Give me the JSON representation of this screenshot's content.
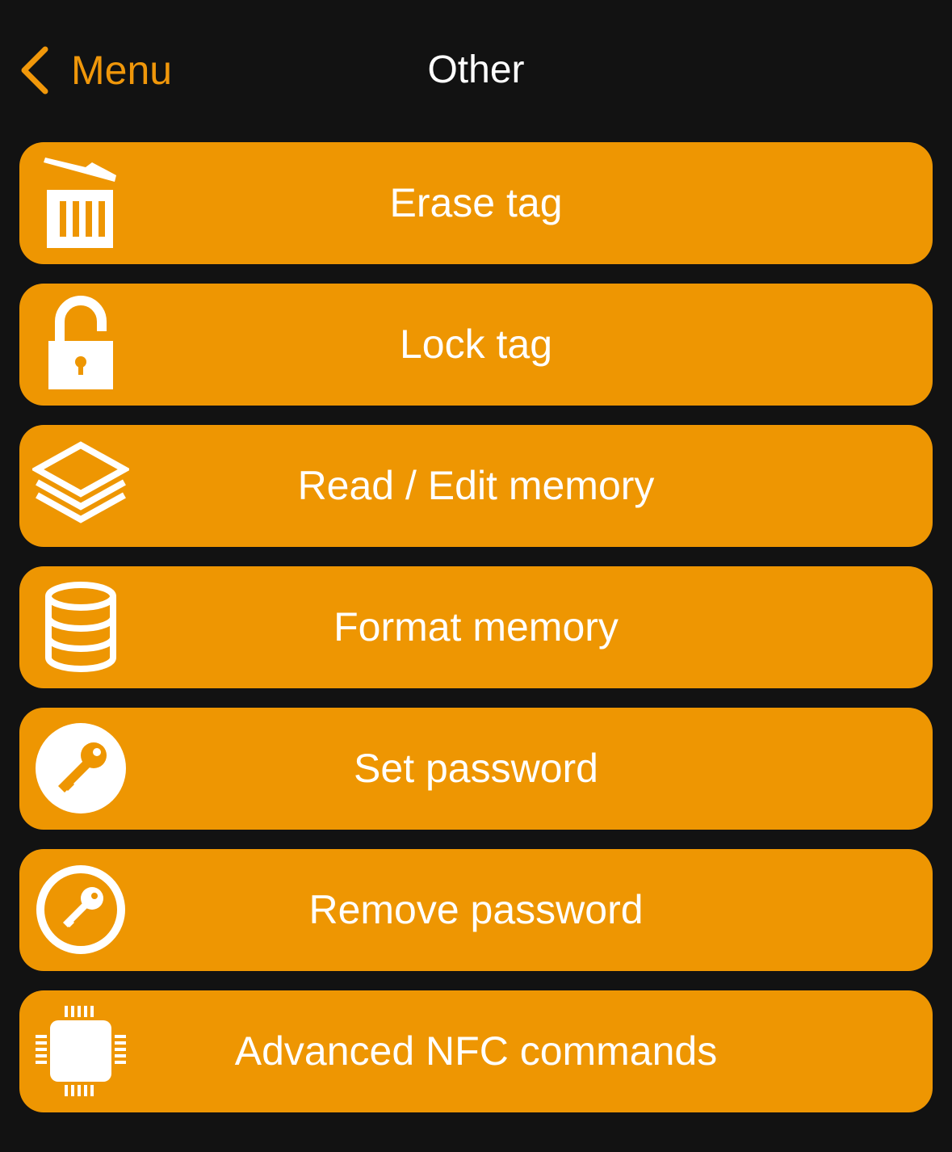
{
  "nav": {
    "back_label": "Menu",
    "title": "Other"
  },
  "colors": {
    "background": "#121212",
    "accent": "#F0970A",
    "button": "#EE9602",
    "text": "#FFFFFF"
  },
  "items": [
    {
      "label": "Erase tag",
      "icon": "trash-icon"
    },
    {
      "label": "Lock tag",
      "icon": "unlock-icon"
    },
    {
      "label": "Read / Edit memory",
      "icon": "layers-icon"
    },
    {
      "label": "Format memory",
      "icon": "database-icon"
    },
    {
      "label": "Set password",
      "icon": "key-icon"
    },
    {
      "label": "Remove password",
      "icon": "key-outline-icon"
    },
    {
      "label": "Advanced NFC commands",
      "icon": "chip-icon"
    }
  ]
}
